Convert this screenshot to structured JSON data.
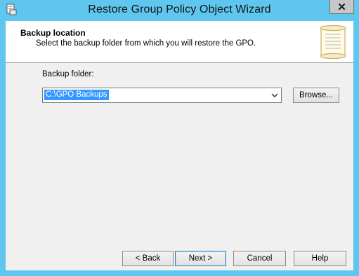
{
  "window": {
    "title": "Restore Group Policy Object Wizard",
    "close_label": "✕",
    "colors": {
      "frame": "#5fc7ef",
      "client": "#f0f0f0",
      "selection": "#3399ff"
    }
  },
  "header": {
    "title": "Backup location",
    "subtitle": "Select the backup folder from which you will restore the GPO.",
    "icon": "scroll-icon"
  },
  "form": {
    "backup_folder_label": "Backup folder:",
    "backup_folder_value": "C:\\GPO Backups",
    "browse_label": "Browse..."
  },
  "footer": {
    "back_label": "< Back",
    "next_label": "Next >",
    "cancel_label": "Cancel",
    "help_label": "Help"
  }
}
